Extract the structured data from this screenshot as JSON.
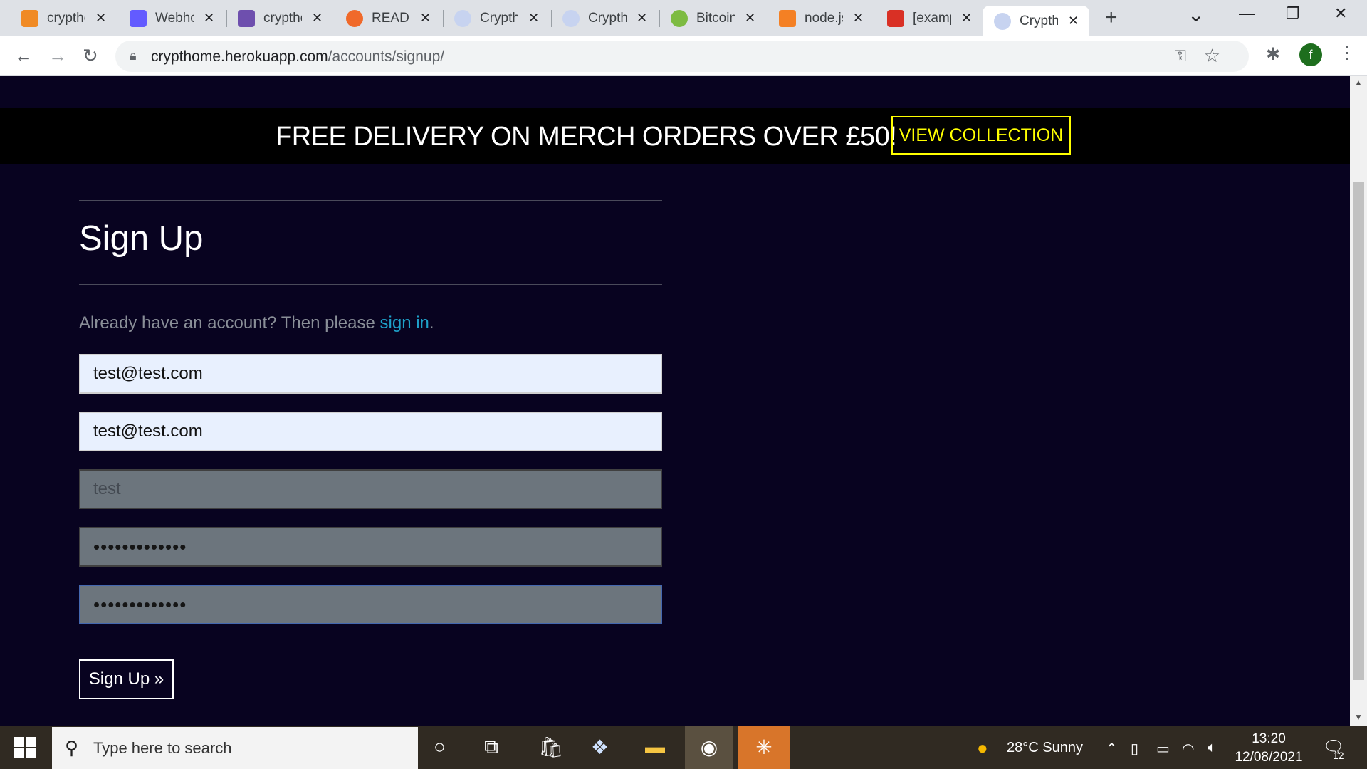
{
  "browser": {
    "tabs": [
      {
        "title": "crypthome",
        "color": "#f08a24"
      },
      {
        "title": "Webhooks",
        "color": "#635bff"
      },
      {
        "title": "crypthome",
        "color": "#6e4fae"
      },
      {
        "title": "README",
        "color": "#f0692a"
      },
      {
        "title": "Crypthome",
        "color": "#c7d3f0"
      },
      {
        "title": "Crypthome",
        "color": "#c7d3f0"
      },
      {
        "title": "Bitcoin",
        "color": "#7dbb42"
      },
      {
        "title": "node.js",
        "color": "#f48024"
      },
      {
        "title": "[example",
        "color": "#d93025"
      },
      {
        "title": "Crypthome",
        "color": "#c7d3f0"
      }
    ],
    "url_host": "crypthome.herokuapp.com",
    "url_path": "/accounts/signup/",
    "profile_initial": "f",
    "new_tab": "+"
  },
  "page": {
    "banner_text": "FREE DELIVERY ON MERCH ORDERS OVER £50!",
    "banner_button": "VIEW COLLECTION",
    "heading": "Sign Up",
    "intro_text": "Already have an account? Then please ",
    "intro_link": "sign in",
    "intro_end": ".",
    "fields": {
      "email": "test@test.com",
      "email_confirm": "test@test.com",
      "username_placeholder": "test",
      "password": "•••••••••••••",
      "password_confirm": "•••••••••••••"
    },
    "submit_label": "Sign Up »"
  },
  "taskbar": {
    "search_placeholder": "Type here to search",
    "weather": "28°C  Sunny",
    "time": "13:20",
    "date": "12/08/2021",
    "notifications": "12"
  }
}
